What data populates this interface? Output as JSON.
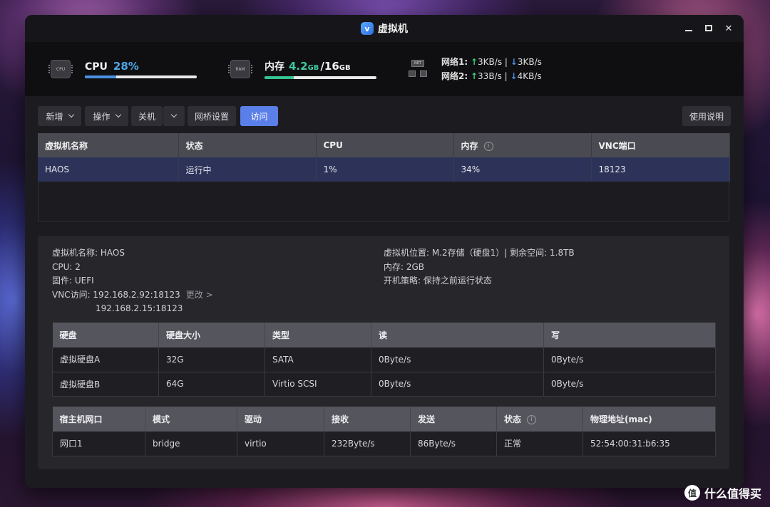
{
  "window": {
    "title": "虚拟机",
    "app_icon_glyph": "v",
    "controls": {
      "minimize": "minimize-icon",
      "maximize": "maximize-icon",
      "close": "close-icon"
    }
  },
  "stats": {
    "cpu": {
      "label": "CPU",
      "value": "28%",
      "fraction": 0.28,
      "icon_text": "CPU"
    },
    "memory": {
      "label": "内存",
      "used": "4.2",
      "used_unit": "GB",
      "separator": "/",
      "total": "16",
      "total_unit": "GB",
      "fraction": 0.2625,
      "icon_text": "RAM"
    },
    "network": {
      "icon_text": "NET",
      "net1": {
        "label": "网络1:",
        "up": "3KB/s",
        "sep": "|",
        "down": "3KB/s"
      },
      "net2": {
        "label": "网络2:",
        "up": "33B/s",
        "sep": "|",
        "down": "4KB/s"
      }
    }
  },
  "toolbar": {
    "new_label": "新增",
    "ops_label": "操作",
    "shutdown_label": "关机",
    "bridge_label": "网桥设置",
    "visit_label": "访问",
    "help_label": "使用说明"
  },
  "vm_table": {
    "headers": [
      "虚拟机名称",
      "状态",
      "CPU",
      "内存",
      "VNC端口"
    ],
    "rows": [
      [
        "HAOS",
        "运行中",
        "1%",
        "34%",
        "18123"
      ]
    ]
  },
  "details": {
    "name": "虚拟机名称: HAOS",
    "cpu": "CPU: 2",
    "firmware": "固件: UEFI",
    "vnc_label": "VNC访问: 192.168.2.92:18123",
    "vnc_change": "更改 >",
    "vnc_second": "192.168.2.15:18123",
    "location": "虚拟机位置: M.2存储（硬盘1）| 剩余空间: 1.8TB",
    "memory": "内存: 2GB",
    "boot": "开机策略: 保持之前运行状态"
  },
  "disk_table": {
    "headers": [
      "硬盘",
      "硬盘大小",
      "类型",
      "读",
      "写"
    ],
    "rows": [
      [
        "虚拟硬盘A",
        "32G",
        "SATA",
        "0Byte/s",
        "0Byte/s"
      ],
      [
        "虚拟硬盘B",
        "64G",
        "Virtio SCSI",
        "0Byte/s",
        "0Byte/s"
      ]
    ]
  },
  "net_table": {
    "headers": [
      "宿主机网口",
      "模式",
      "驱动",
      "接收",
      "发送",
      "状态",
      "物理地址(mac)"
    ],
    "rows": [
      [
        "网口1",
        "bridge",
        "virtio",
        "232Byte/s",
        "86Byte/s",
        "正常",
        "52:54:00:31:b6:35"
      ]
    ]
  },
  "watermark": {
    "icon_text": "值",
    "text": "什么值得买"
  }
}
